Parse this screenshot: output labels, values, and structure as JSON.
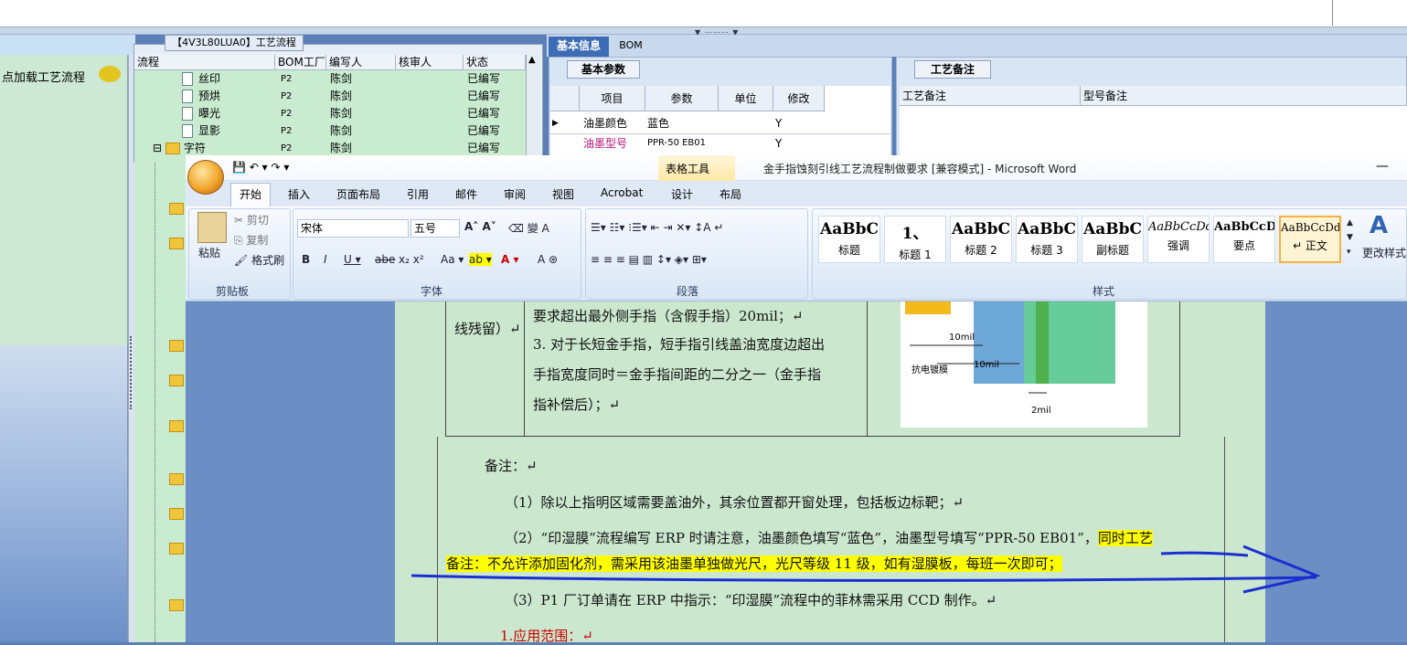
{
  "left_panel": {
    "load_label": "点加载工艺流程"
  },
  "process_tree": {
    "title": "【4V3L80LUA0】工艺流程",
    "headers": [
      "流程",
      "BOM工厂",
      "编写人",
      "核审人",
      "状态"
    ],
    "rows": [
      {
        "name": "丝印",
        "factory": "P2",
        "writer": "陈剑",
        "reviewer": "",
        "status": "已编写"
      },
      {
        "name": "预烘",
        "factory": "P2",
        "writer": "陈剑",
        "reviewer": "",
        "status": "已编写"
      },
      {
        "name": "曝光",
        "factory": "P2",
        "writer": "陈剑",
        "reviewer": "",
        "status": "已编写"
      },
      {
        "name": "显影",
        "factory": "P2",
        "writer": "陈剑",
        "reviewer": "",
        "status": "已编写"
      },
      {
        "name": "字符",
        "factory": "P2",
        "writer": "陈剑",
        "reviewer": "",
        "status": "已编写"
      }
    ]
  },
  "info": {
    "tabs": [
      "基本信息",
      "BOM"
    ],
    "basic_params_title": "基本参数",
    "param_headers": [
      "项目",
      "参数",
      "单位",
      "修改"
    ],
    "params": [
      {
        "item": "油墨颜色",
        "value": "蓝色",
        "unit": "",
        "modify": "Y"
      },
      {
        "item": "油墨型号",
        "value": "PPR-50 EB01",
        "unit": "",
        "modify": "Y"
      }
    ],
    "remark_title": "工艺备注",
    "remark_headers": [
      "工艺备注",
      "型号备注"
    ]
  },
  "word": {
    "context_tab": "表格工具",
    "window_title": "金手指蚀刻引线工艺流程制做要求 [兼容模式] - Microsoft Word",
    "tabs": [
      "开始",
      "插入",
      "页面布局",
      "引用",
      "邮件",
      "审阅",
      "视图",
      "Acrobat",
      "设计",
      "布局"
    ],
    "clipboard": {
      "paste": "粘贴",
      "cut": "剪切",
      "copy": "复制",
      "format_painter": "格式刷",
      "label": "剪贴板"
    },
    "font": {
      "name": "宋体",
      "size": "五号",
      "label": "字体"
    },
    "paragraph_label": "段落",
    "styles": [
      {
        "preview": "AaBbC",
        "name": "标题"
      },
      {
        "preview": "1、",
        "name": "标题 1"
      },
      {
        "preview": "AaBbC",
        "name": "标题 2"
      },
      {
        "preview": "AaBbC",
        "name": "标题 3"
      },
      {
        "preview": "AaBbC",
        "name": "副标题"
      },
      {
        "preview": "AaBbCcDd",
        "name": "强调"
      },
      {
        "preview": "AaBbCcD",
        "name": "要点"
      },
      {
        "preview": "AaBbCcDd",
        "name": "↵ 正文"
      }
    ],
    "styles_label": "样式",
    "change_styles": "更改样式"
  },
  "document": {
    "cell_left": "线残留）↵",
    "cell_lines": [
      "要求超出最外侧手指（含假手指）20mil；↵",
      "3. 对于长短金手指，短手指引线盖油宽度边超出",
      "手指宽度同时＝金手指间距的二分之一（金手指",
      "指补偿后）；↵"
    ],
    "diagram_labels": [
      "10mil",
      "10mil",
      "抗电镀膜",
      "2mil"
    ],
    "remark_heading": "备注：↵",
    "item1": "（1）除以上指明区域需要盖油外，其余位置都开窗处理，包括板边标靶；↵",
    "item2_part1": "（2）“印湿膜”流程编写 ERP 时请注意，油墨颜色填写“蓝色”，油墨型号填写“PPR-50 EB01”，",
    "item2_hl_a": "同时工艺",
    "item2_hl_b": "备注：不允许添加固化剂，需采用该油墨单独做光尺，光尺等级 11 级，如有湿膜板，每班一次即可；",
    "item3": "（3）P1 厂订单请在 ERP 中指示：“印湿膜”流程中的菲林需采用 CCD 制作。↵",
    "section1": "1.应用范围：↵"
  },
  "colors": {
    "highlight": "#ffff00",
    "doc_bg": "#cbe8cf",
    "annotation": "#1b2fd1",
    "tab_active": "#3c6cb4"
  }
}
